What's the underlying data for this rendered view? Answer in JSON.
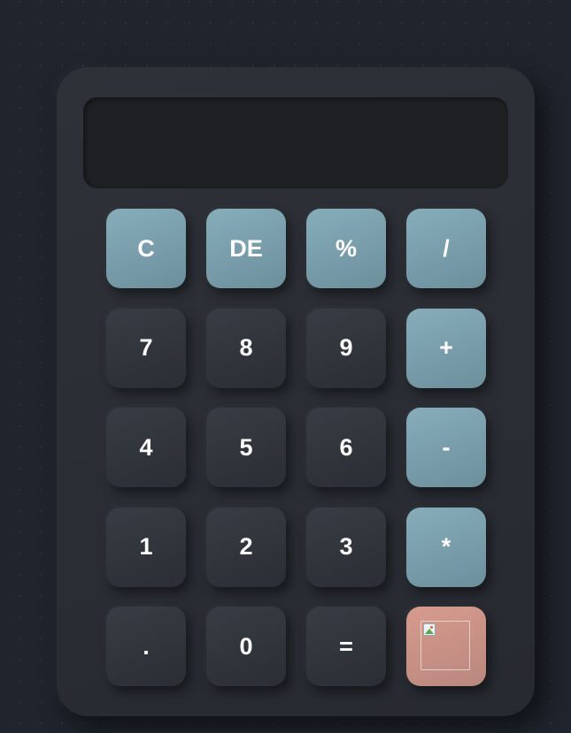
{
  "display": {
    "value": ""
  },
  "keys": {
    "clear": "C",
    "delete": "DE",
    "percent": "%",
    "divide": "/",
    "seven": "7",
    "eight": "8",
    "nine": "9",
    "plus": "+",
    "four": "4",
    "five": "5",
    "six": "6",
    "minus": "-",
    "one": "1",
    "two": "2",
    "three": "3",
    "multiply": "*",
    "decimal": ".",
    "zero": "0",
    "equals": "="
  },
  "mode_button": {
    "icon": "broken-image-icon"
  },
  "colors": {
    "background": "#1f242d",
    "body": "#2b2e34",
    "display": "#1e2024",
    "number_key": "#34373e",
    "operator_key": "#7b9fac",
    "mode_key": "#c9918a",
    "text": "#ffffff"
  }
}
